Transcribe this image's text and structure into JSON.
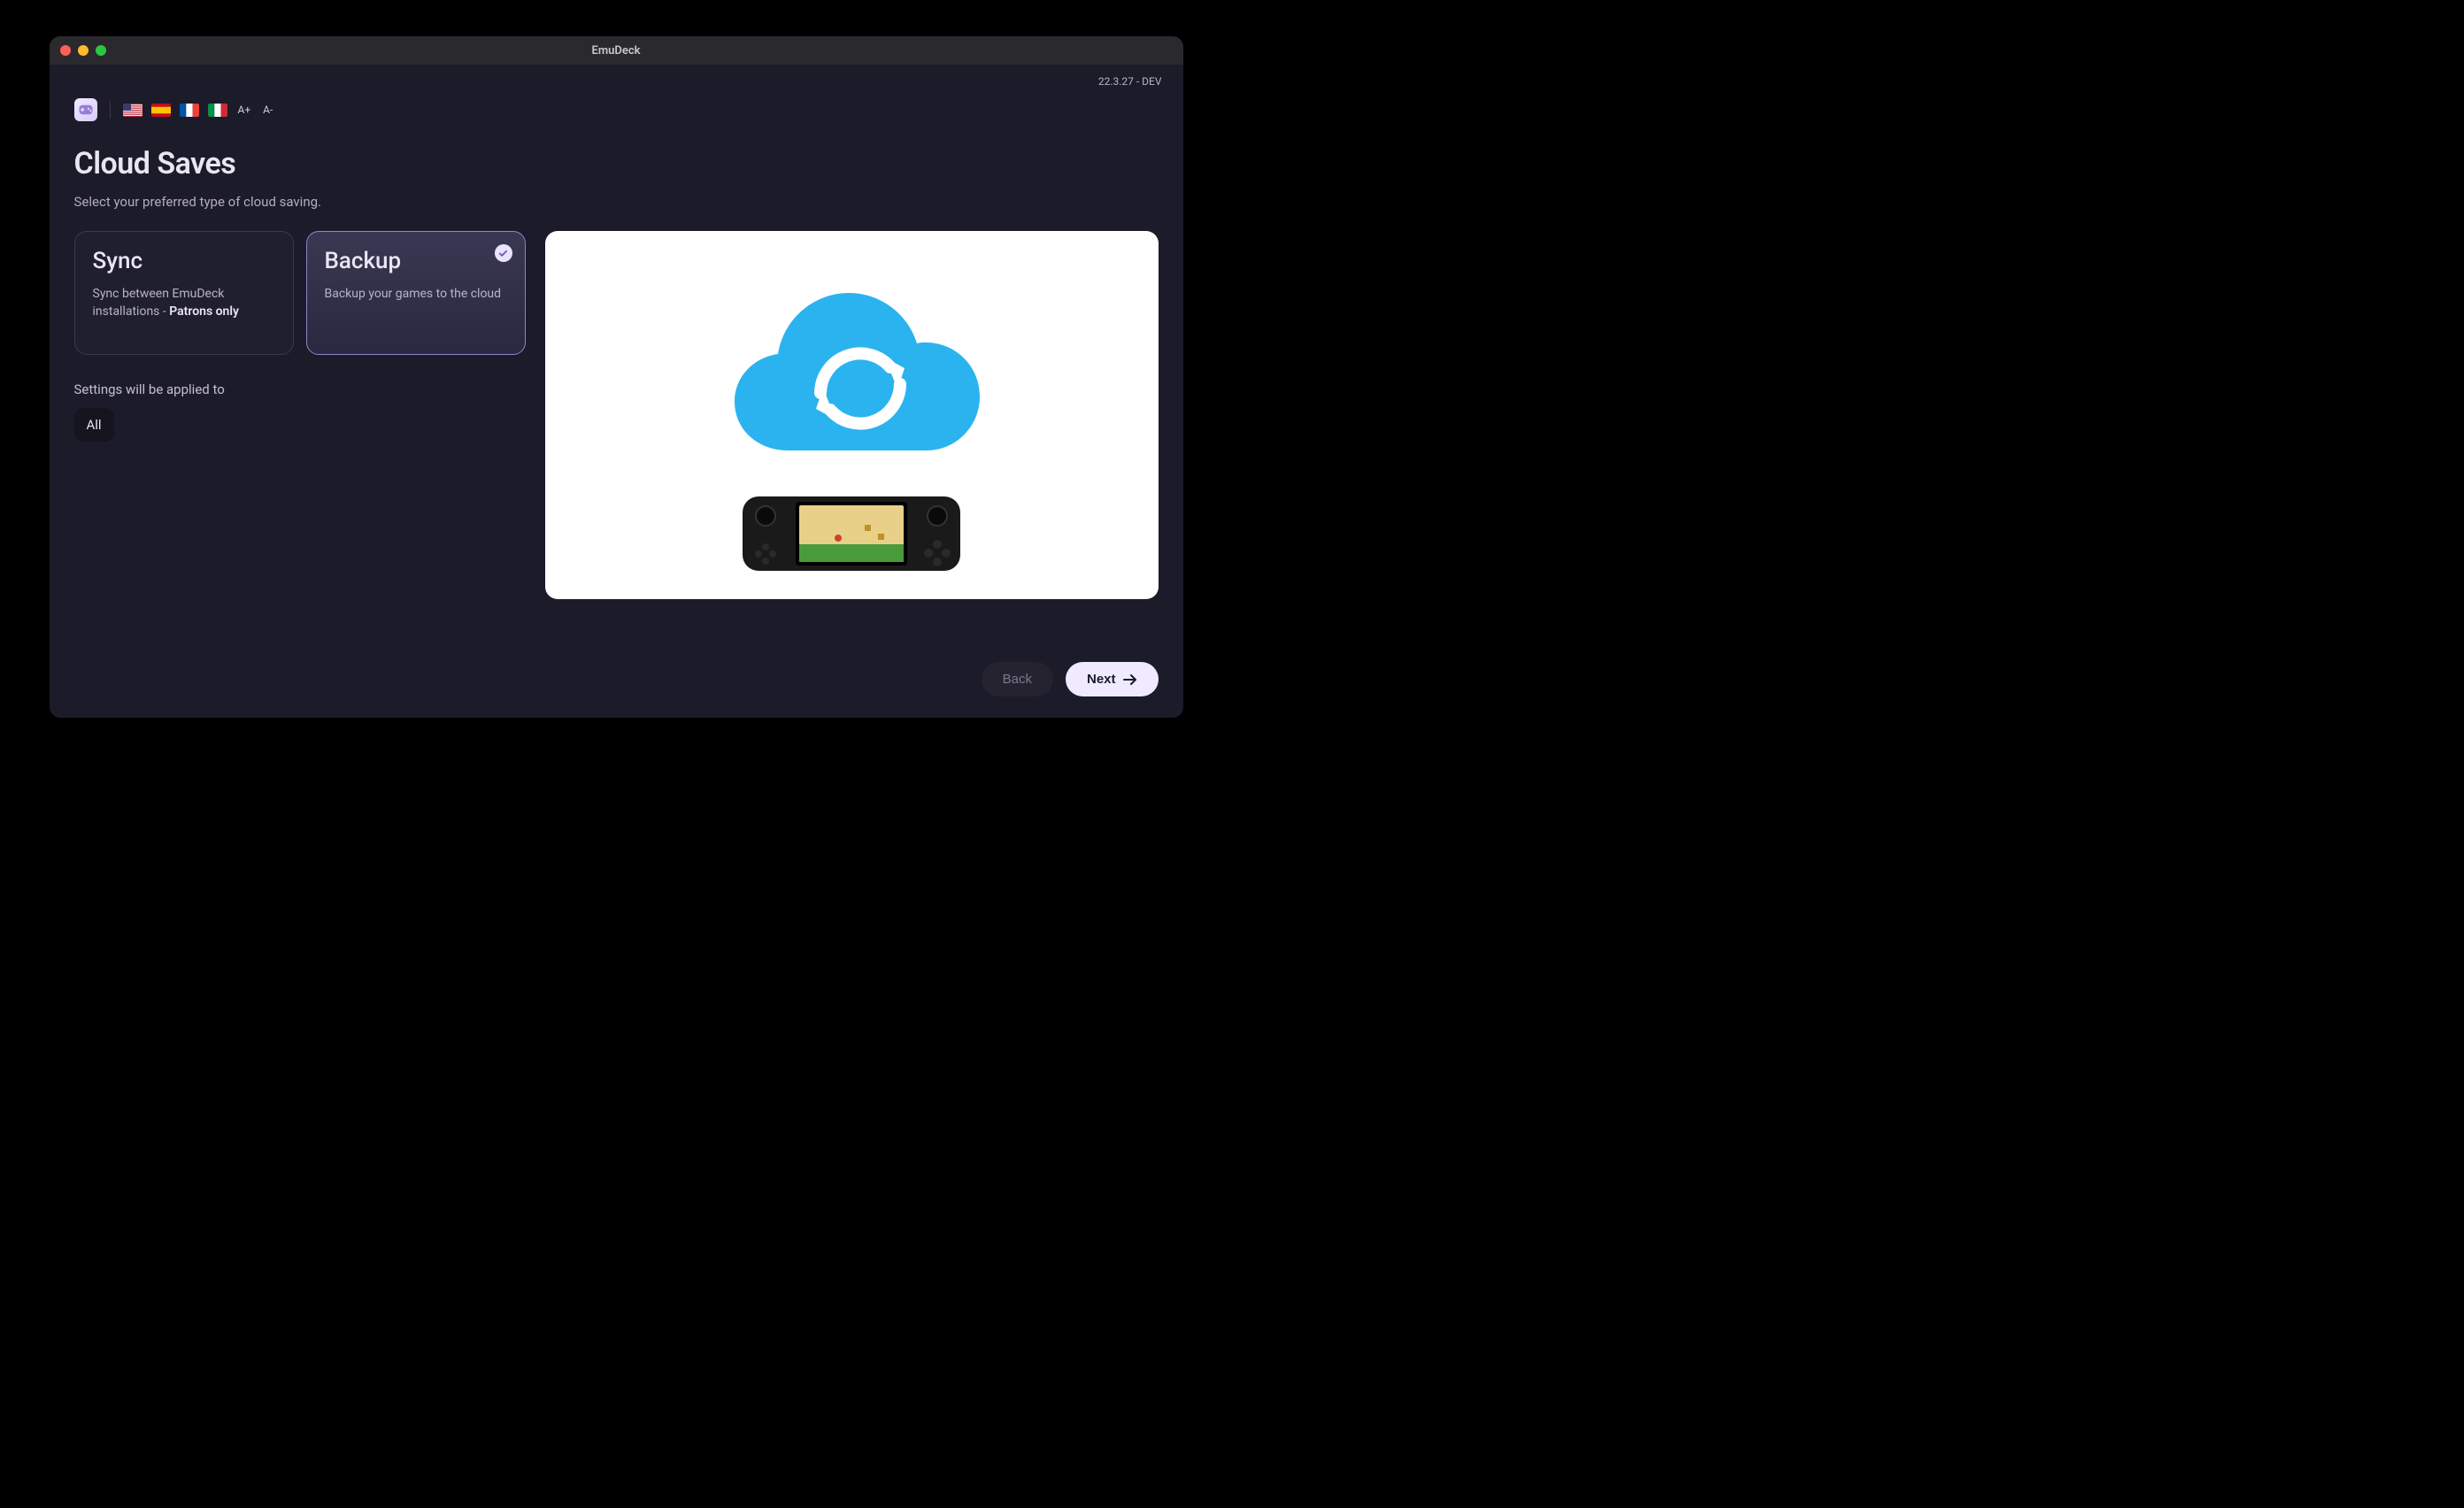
{
  "window": {
    "title": "EmuDeck"
  },
  "version": "22.3.27 - DEV",
  "toolbar": {
    "flags": [
      "us",
      "es",
      "fr",
      "it"
    ],
    "font_up": "A+",
    "font_down": "A-"
  },
  "page": {
    "title": "Cloud Saves",
    "subtitle": "Select your preferred type of cloud saving."
  },
  "options": {
    "sync": {
      "title": "Sync",
      "desc_prefix": "Sync between EmuDeck installations - ",
      "desc_strong": "Patrons only",
      "selected": false
    },
    "backup": {
      "title": "Backup",
      "desc": "Backup your games to the cloud",
      "selected": true
    }
  },
  "settings": {
    "applied_label": "Settings will be applied to",
    "applied_value": "All"
  },
  "footer": {
    "back": "Back",
    "next": "Next"
  }
}
